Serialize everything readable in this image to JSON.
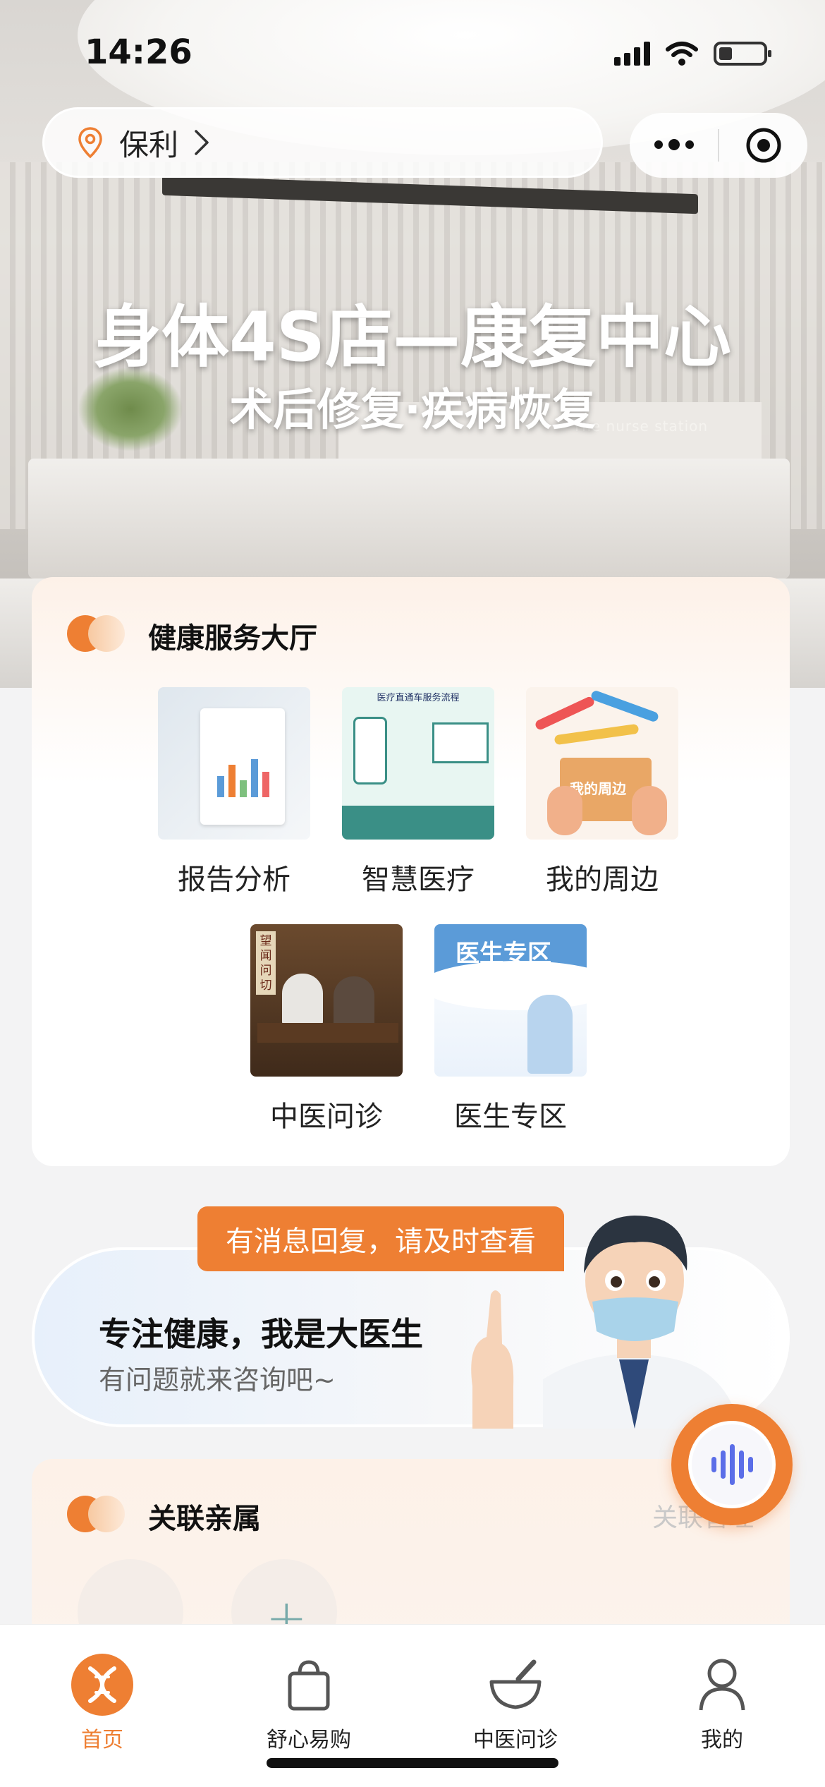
{
  "status_bar": {
    "time": "14:26"
  },
  "location": {
    "name": "保利"
  },
  "hero": {
    "headline": "身体4S店—康复中心",
    "subline": "术后修复·疾病恢复",
    "sign_text": "The nurse station"
  },
  "service_hall": {
    "title": "健康服务大厅",
    "items": [
      {
        "label": "报告分析",
        "icon": "report-analysis-thumb"
      },
      {
        "label": "智慧医疗",
        "icon": "smart-medical-thumb",
        "thumb_text": "医疗直通车服务流程"
      },
      {
        "label": "我的周边",
        "icon": "my-surroundings-thumb",
        "thumb_text": "我的周边"
      },
      {
        "label": "中医问诊",
        "icon": "tcm-consult-thumb",
        "thumb_text": "望闻问切"
      },
      {
        "label": "医生专区",
        "icon": "doctor-zone-thumb",
        "thumb_text": "医生专区"
      }
    ]
  },
  "doctor_banner": {
    "message_tag": "有消息回复，请及时查看",
    "title": "专注健康，我是大医生",
    "subtitle": "有问题就来咨询吧~"
  },
  "relatives": {
    "title": "关联亲属",
    "more_label": "关联管理"
  },
  "tabbar": {
    "tabs": [
      {
        "label": "首页",
        "icon": "dna-icon",
        "active": true
      },
      {
        "label": "舒心易购",
        "icon": "shopping-bag-icon",
        "active": false
      },
      {
        "label": "中医问诊",
        "icon": "mortar-pestle-icon",
        "active": false
      },
      {
        "label": "我的",
        "icon": "user-icon",
        "active": false
      }
    ]
  },
  "colors": {
    "accent": "#ee7f33",
    "voice_wave": "#5b6ee8",
    "page_bg": "#f3f3f4"
  }
}
